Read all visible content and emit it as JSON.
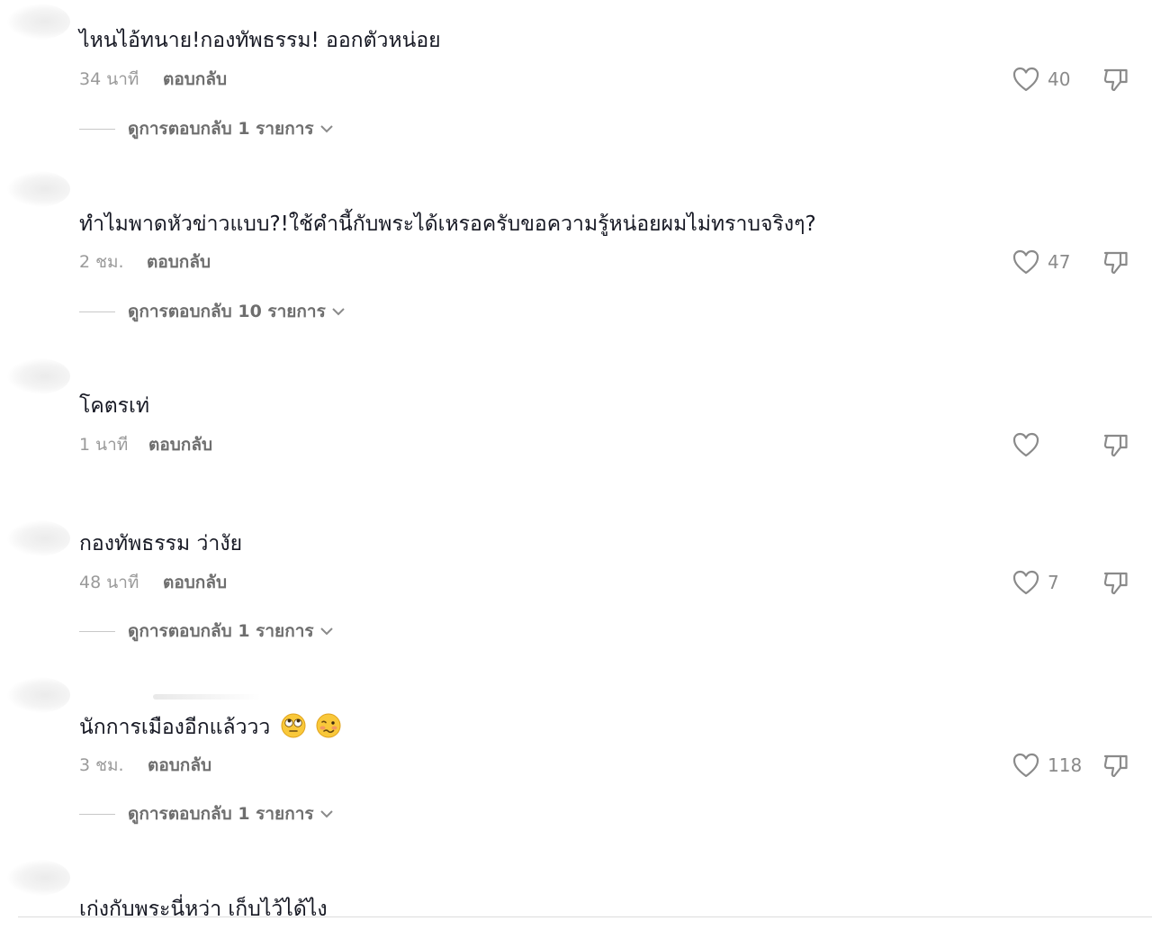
{
  "comments": [
    {
      "text": "ไหนไอ้ทนาย!กองทัพธรรม! ออกตัวหน่อย",
      "time": "34 นาที",
      "reply_label": "ตอบกลับ",
      "likes": "40",
      "view_replies": "ดูการตอบกลับ 1 รายการ"
    },
    {
      "text": "ทำไมพาดหัวข่าวแบบ?!ใช้คำนี้กับพระได้เหรอครับขอความรู้หน่อยผมไม่ทราบจริงๆ?",
      "time": "2 ชม.",
      "reply_label": "ตอบกลับ",
      "likes": "47",
      "view_replies": "ดูการตอบกลับ 10 รายการ"
    },
    {
      "text": "โคตรเท่",
      "time": "1 นาที",
      "reply_label": "ตอบกลับ",
      "likes": ""
    },
    {
      "text": "กองทัพธรรม ว่างัย",
      "time": "48 นาที",
      "reply_label": "ตอบกลับ",
      "likes": "7",
      "view_replies": "ดูการตอบกลับ 1 รายการ"
    },
    {
      "text": "นักการเมืองอีกแล้ววว",
      "emojis": [
        "face-with-rolling-eyes-emoji",
        "woozy-face-emoji"
      ],
      "time": "3 ชม.",
      "reply_label": "ตอบกลับ",
      "likes": "118",
      "view_replies": "ดูการตอบกลับ 1 รายการ"
    },
    {
      "text": "เก่งกับพระนี่หว่า เก็บไว้ได้ไง"
    }
  ],
  "icons": {
    "like": "heart-outline-icon",
    "dislike": "thumbs-down-outline-icon",
    "expand": "chevron-down-icon"
  },
  "colors": {
    "text": "#161823",
    "muted": "#9a9a9a",
    "reply": "#6e6e6e"
  }
}
